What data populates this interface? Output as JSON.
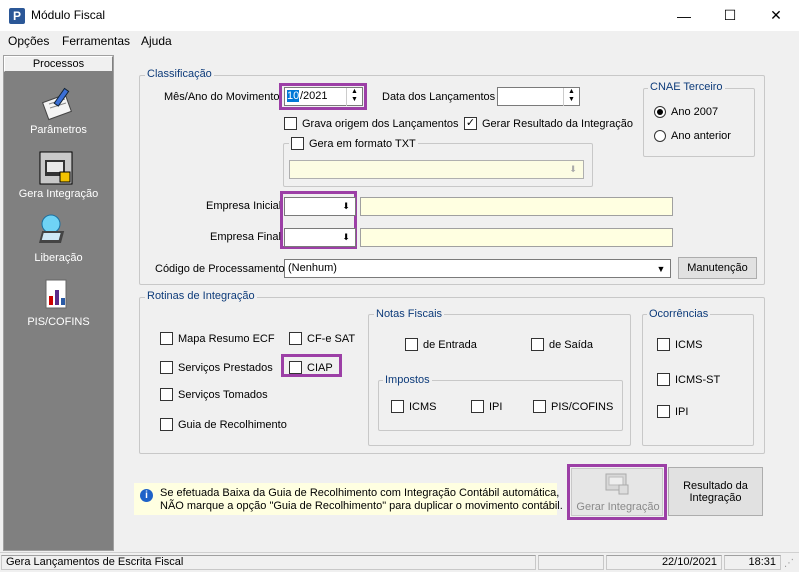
{
  "window": {
    "title": "Módulo Fiscal",
    "app_icon": "P"
  },
  "menu": [
    "Opções",
    "Ferramentas",
    "Ajuda"
  ],
  "sidebar": {
    "tab": "Processos",
    "items": [
      {
        "label": "Parâmetros",
        "icon": "parameters-icon"
      },
      {
        "label": "Gera Integração",
        "icon": "integration-icon"
      },
      {
        "label": "Liberação",
        "icon": "release-icon"
      },
      {
        "label": "PIS/COFINS",
        "icon": "pis-cofins-icon"
      }
    ]
  },
  "classificacao": {
    "legend": "Classificação",
    "mes_ano_label": "Mês/Ano do Movimento",
    "mes_ano_sel": "10",
    "mes_ano_rest": "/2021",
    "data_lanc_label": "Data dos Lançamentos",
    "grava_origem": "Grava origem dos Lançamentos",
    "gerar_resultado": "Gerar Resultado da Integração",
    "gera_txt": "Gera em formato TXT",
    "empresa_inicial": "Empresa Inicial",
    "empresa_final": "Empresa Final",
    "codigo_proc_label": "Código de Processamento",
    "codigo_proc_value": "(Nenhum)",
    "manutencao": "Manutenção"
  },
  "cnae": {
    "legend": "CNAE Terceiro",
    "opt1": "Ano 2007",
    "opt2": "Ano anterior"
  },
  "rotinas": {
    "legend": "Rotinas de Integração",
    "mapa": "Mapa Resumo ECF",
    "cfe": "CF-e SAT",
    "servicos_prestados": "Serviços Prestados",
    "ciap": "CIAP",
    "servicos_tomados": "Serviços Tomados",
    "guia": "Guia de Recolhimento"
  },
  "notas": {
    "legend": "Notas Fiscais",
    "entrada": "de Entrada",
    "saida": "de Saída",
    "impostos_legend": "Impostos",
    "icms": "ICMS",
    "ipi": "IPI",
    "pis": "PIS/COFINS"
  },
  "ocorrencias": {
    "legend": "Ocorrências",
    "icms": "ICMS",
    "icms_st": "ICMS-ST",
    "ipi": "IPI"
  },
  "info": {
    "line1": "Se efetuada Baixa da Guia de Recolhimento com Integração Contábil automática,",
    "line2": "NÃO marque a opção \"Guia de Recolhimento\" para duplicar o movimento contábil."
  },
  "buttons": {
    "gerar": "Gerar Integração",
    "resultado_l1": "Resultado da",
    "resultado_l2": "Integração"
  },
  "status": {
    "text": "Gera Lançamentos de Escrita Fiscal",
    "date": "22/10/2021",
    "time": "18:31"
  }
}
